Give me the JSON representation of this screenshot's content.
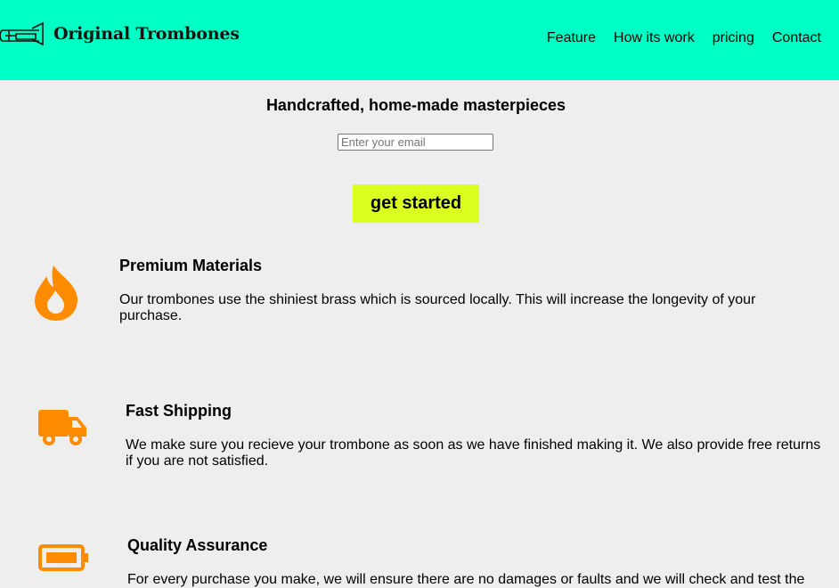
{
  "header": {
    "logo_text": "Original Trombones",
    "logo_icon": "trombone-icon",
    "nav": [
      "Feature",
      "How its work",
      "pricing",
      "Contact"
    ]
  },
  "hero": {
    "title": "Handcrafted, home-made masterpieces",
    "email_placeholder": "Enter your email",
    "email_value": "",
    "cta_label": "get started"
  },
  "features": [
    {
      "icon": "fire-icon",
      "title": "Premium Materials",
      "description": "Our trombones use the shiniest brass which is sourced locally. This will increase the longevity of your purchase."
    },
    {
      "icon": "truck-icon",
      "title": "Fast Shipping",
      "description": "We make sure you recieve your trombone as soon as we have finished making it. We also provide free returns if you are not satisfied."
    },
    {
      "icon": "battery-icon",
      "title": "Quality Assurance",
      "description": "For every purchase you make, we will ensure there are no damages or faults and we will check and test the"
    }
  ],
  "colors": {
    "header_bg": "#00ffc4",
    "page_bg": "#eeeeee",
    "cta_bg": "#dbff1f",
    "icon_orange": "#ff8c00"
  }
}
